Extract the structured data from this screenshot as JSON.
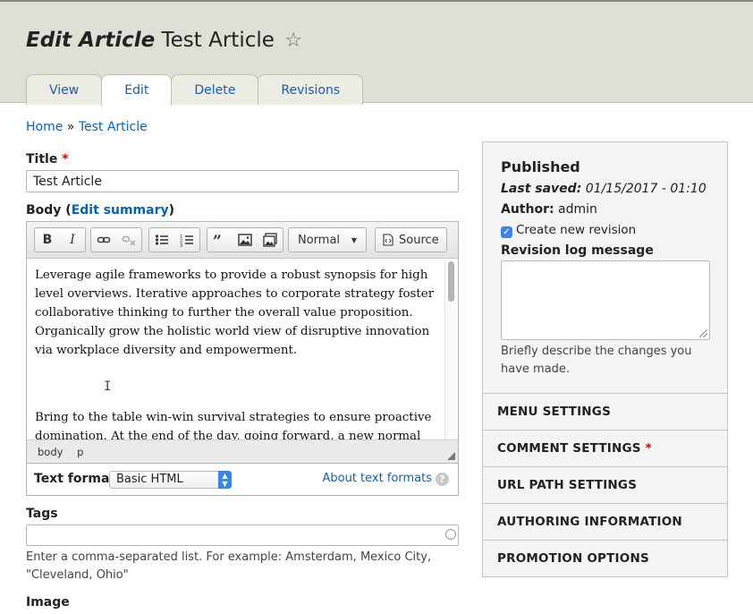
{
  "header": {
    "title_prefix": "Edit Article",
    "title_name": "Test Article",
    "tabs": [
      {
        "label": "View"
      },
      {
        "label": "Edit"
      },
      {
        "label": "Delete"
      },
      {
        "label": "Revisions"
      }
    ]
  },
  "breadcrumb": {
    "home": "Home",
    "separator": "»",
    "current": "Test Article"
  },
  "title_field": {
    "label": "Title",
    "required": "*",
    "value": "Test Article"
  },
  "body_field": {
    "label": "Body",
    "summary_link": "Edit summary",
    "toolbar": {
      "bold": "B",
      "italic": "I",
      "format_select": "Normal",
      "source": "Source"
    },
    "paragraphs": [
      "Leverage agile frameworks to provide a robust synopsis for high level overviews. Iterative approaches to corporate strategy foster collaborative thinking to further the overall value proposition. Organically grow the holistic world view of disruptive innovation via workplace diversity and empowerment.",
      "Bring to the table win-win survival strategies to ensure proactive domination. At the end of the day, going forward, a new normal that has"
    ],
    "path": [
      "body",
      "p"
    ],
    "text_format_label": "Text format",
    "text_format_value": "Basic HTML",
    "about_formats": "About text formats",
    "help": "?"
  },
  "tags_field": {
    "label": "Tags",
    "value": "",
    "description": "Enter a comma-separated list. For example: Amsterdam, Mexico City, \"Cleveland, Ohio\""
  },
  "image_field": {
    "label": "Image"
  },
  "sidebar": {
    "status": "Published",
    "last_saved_label": "Last saved:",
    "last_saved_value": "01/15/2017 - 01:10",
    "author_label": "Author:",
    "author_value": "admin",
    "create_revision": "Create new revision",
    "create_revision_checked": true,
    "revision_log_label": "Revision log message",
    "revision_log_value": "",
    "revision_log_desc": "Briefly describe the changes you have made.",
    "sections": [
      {
        "label": "MENU SETTINGS",
        "required": ""
      },
      {
        "label": "COMMENT SETTINGS",
        "required": "*"
      },
      {
        "label": "URL PATH SETTINGS",
        "required": ""
      },
      {
        "label": "AUTHORING INFORMATION",
        "required": ""
      },
      {
        "label": "PROMOTION OPTIONS",
        "required": ""
      }
    ]
  },
  "colors": {
    "link": "#0b63a7",
    "required": "#cc0000",
    "header_bg": "#e0dfd6",
    "checkbox": "#3f84e5"
  }
}
